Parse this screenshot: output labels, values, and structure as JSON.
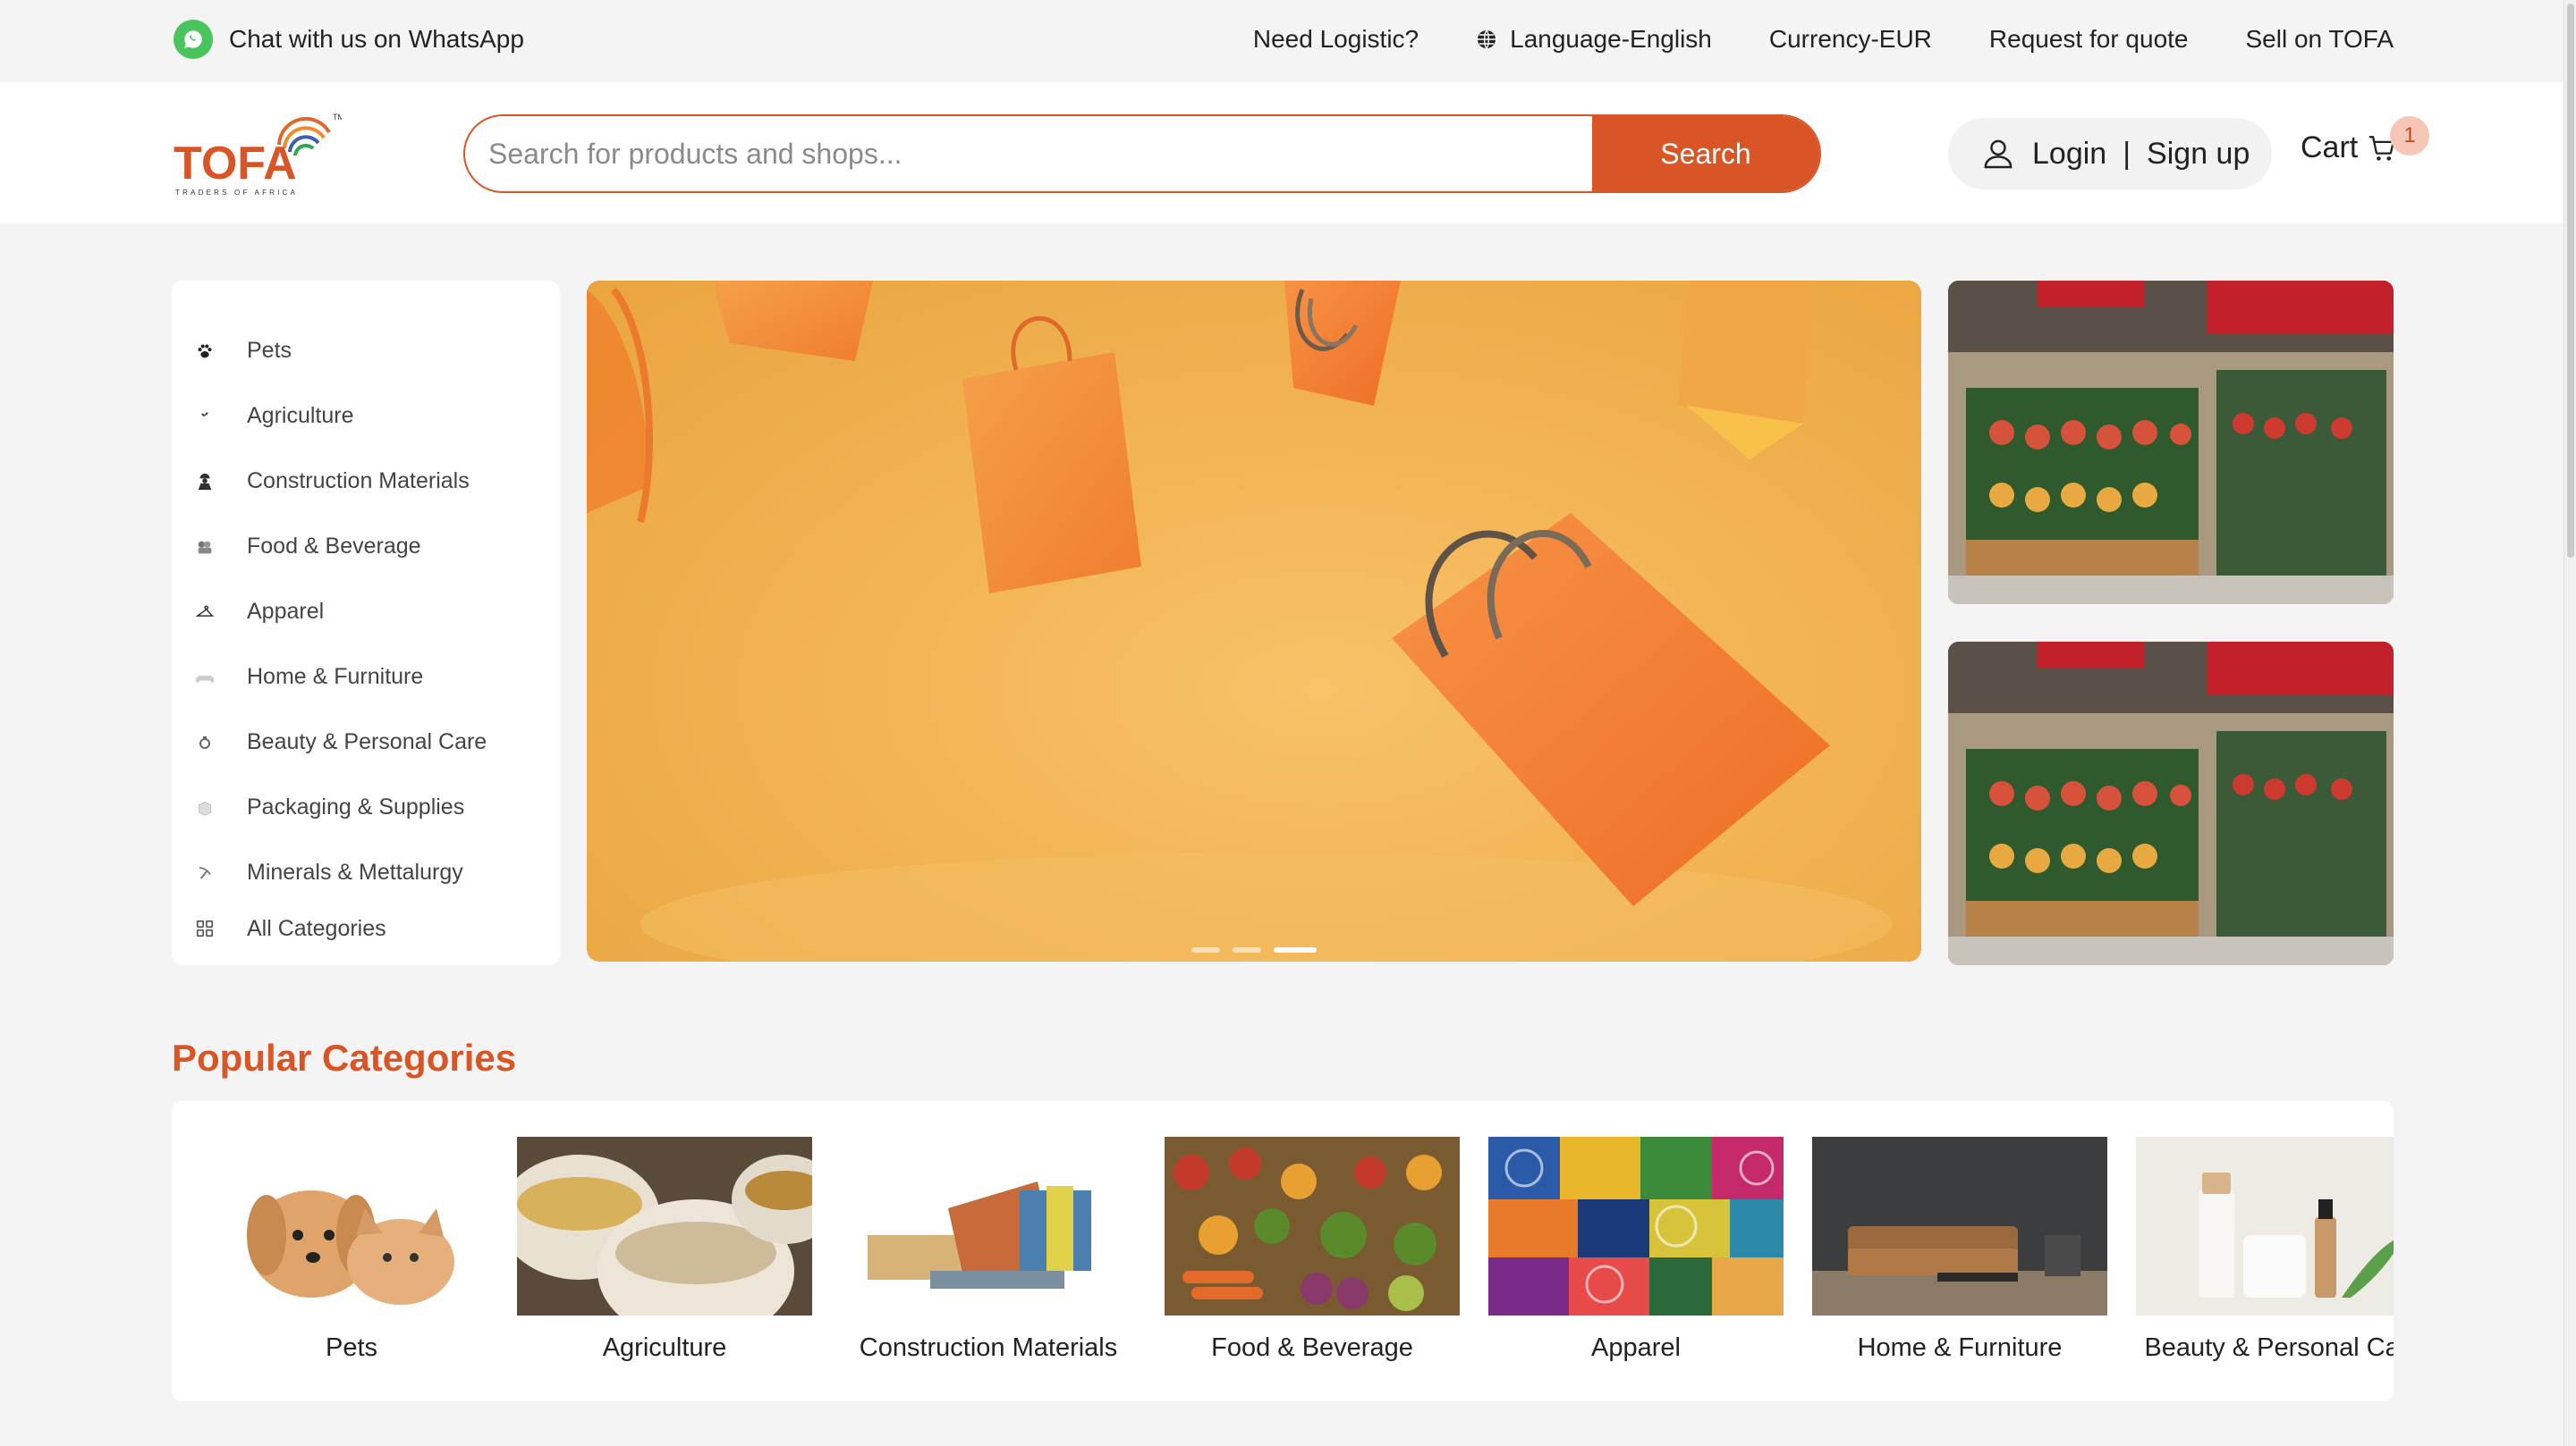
{
  "topbar": {
    "whatsapp": "Chat with us on WhatsApp",
    "logistic": "Need Logistic?",
    "language": "Language-English",
    "currency": "Currency-EUR",
    "quote": "Request for quote",
    "sell": "Sell on TOFA"
  },
  "header": {
    "logo_text": "TOFA",
    "logo_tagline": "TRADERS OF AFRICA",
    "search_placeholder": "Search for products and shops...",
    "search_button": "Search",
    "login": "Login",
    "separator": "|",
    "signup": "Sign up",
    "cart": "Cart",
    "cart_count": "1"
  },
  "sidebar": {
    "items": [
      {
        "label": "Pets",
        "icon": "paw-icon"
      },
      {
        "label": "Agriculture",
        "icon": "plant-icon"
      },
      {
        "label": "Construction Materials",
        "icon": "worker-icon"
      },
      {
        "label": "Food & Beverage",
        "icon": "food-icon"
      },
      {
        "label": "Apparel",
        "icon": "hanger-icon"
      },
      {
        "label": "Home & Furniture",
        "icon": "sofa-icon"
      },
      {
        "label": "Beauty & Personal Care",
        "icon": "beauty-icon"
      },
      {
        "label": "Packaging & Supplies",
        "icon": "box-icon"
      },
      {
        "label": "Minerals & Mettalurgy",
        "icon": "pickaxe-icon"
      },
      {
        "label": "All Categories",
        "icon": "grid-icon"
      }
    ]
  },
  "banner": {
    "slides": 3,
    "active_slide": 3
  },
  "popular": {
    "title": "Popular Categories",
    "items": [
      {
        "label": "Pets"
      },
      {
        "label": "Agriculture"
      },
      {
        "label": "Construction Materials"
      },
      {
        "label": "Food & Beverage"
      },
      {
        "label": "Apparel"
      },
      {
        "label": "Home & Furniture"
      },
      {
        "label": "Beauty & Personal Care"
      }
    ]
  },
  "colors": {
    "accent": "#d95525",
    "whatsapp": "#4ac45d",
    "banner": "#f1b150"
  }
}
